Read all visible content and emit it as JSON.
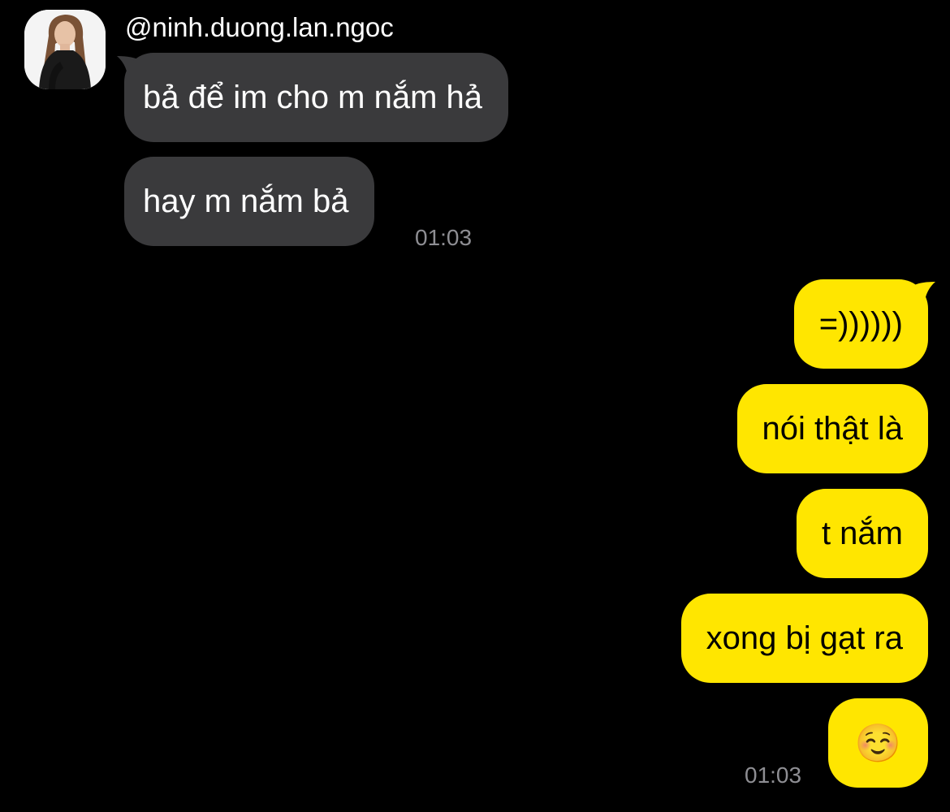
{
  "conversation": {
    "sender_handle": "@ninh.duong.lan.ngoc",
    "avatar_icon": "profile-photo",
    "incoming": [
      {
        "text": "bả để im cho m nắm hả"
      },
      {
        "text": "hay m nắm bả"
      }
    ],
    "incoming_time": "01:03",
    "outgoing": [
      {
        "text": "=))))))"
      },
      {
        "text": "nói thật là"
      },
      {
        "text": "t nắm"
      },
      {
        "text": "xong bị gạt ra"
      },
      {
        "text": "☺️"
      }
    ],
    "outgoing_time": "01:03"
  },
  "colors": {
    "background": "#000000",
    "incoming_bubble": "#3a3a3c",
    "outgoing_bubble": "#ffe600",
    "timestamp": "#8e8e93"
  }
}
